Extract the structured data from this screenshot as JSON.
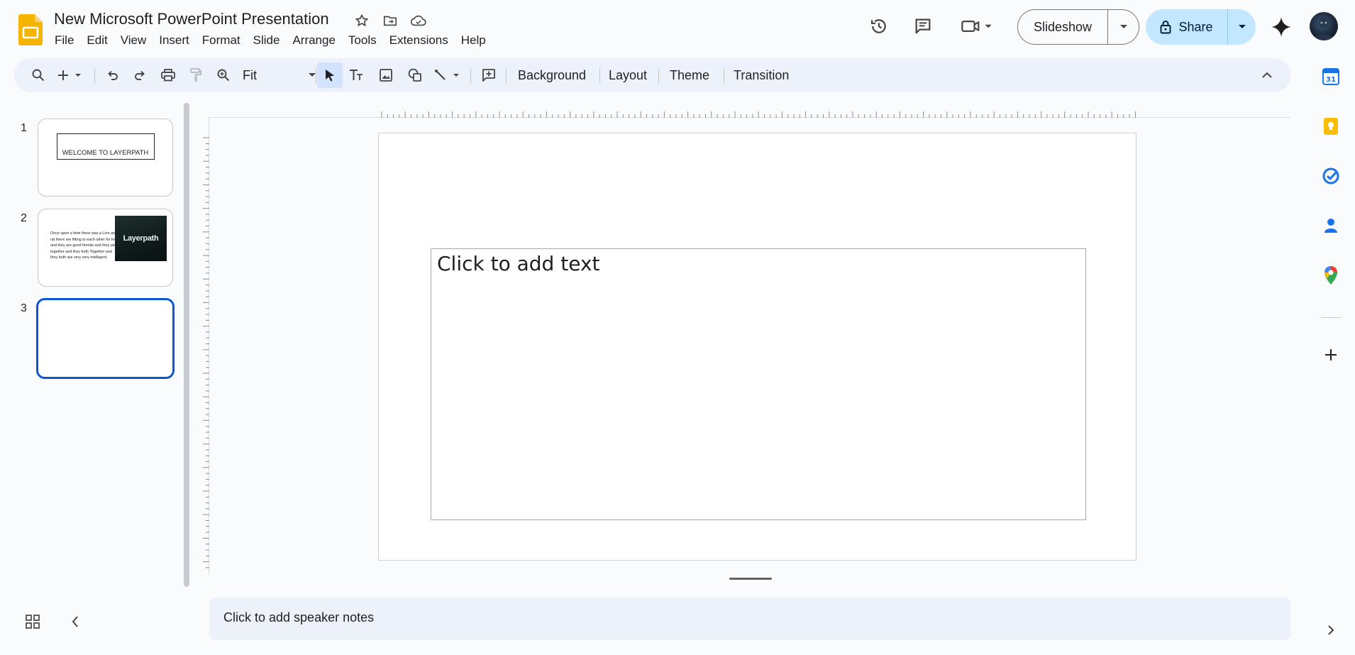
{
  "header": {
    "doc_title": "New Microsoft PowerPoint Presentation",
    "slideshow_label": "Slideshow",
    "share_label": "Share"
  },
  "menu": [
    "File",
    "Edit",
    "View",
    "Insert",
    "Format",
    "Slide",
    "Arrange",
    "Tools",
    "Extensions",
    "Help"
  ],
  "toolbar": {
    "zoom_value": "Fit",
    "background_label": "Background",
    "layout_label": "Layout",
    "theme_label": "Theme",
    "transition_label": "Transition"
  },
  "slides": [
    {
      "number": "1",
      "title": "WELCOME TO LAYERPATH"
    },
    {
      "number": "2",
      "body": "Once upon a time there was a Lion and rat there are fitting to each other for food and they are good friends and they play together and they both Together and they both are very very intelligent.",
      "image_label": "Layerpath"
    },
    {
      "number": "3"
    }
  ],
  "canvas": {
    "placeholder": "Click to add text"
  },
  "notes": {
    "placeholder": "Click to add speaker notes"
  },
  "colors": {
    "accent": "#0b57d0",
    "share_bg": "#c2e7ff",
    "toolbar_bg": "#edf2fa",
    "page_bg": "#f9fbfd"
  }
}
